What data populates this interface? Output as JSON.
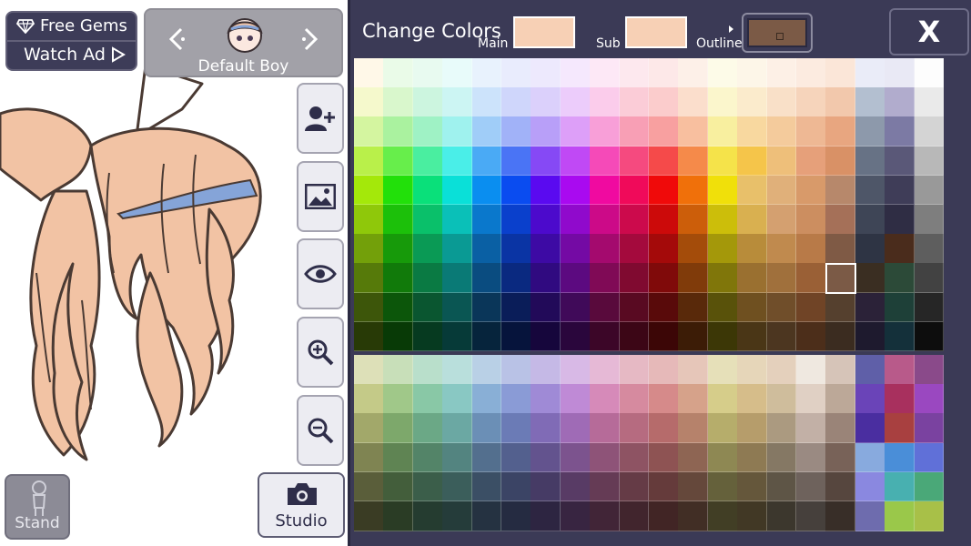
{
  "gems": {
    "label": "Free Gems",
    "icon": "gem-icon"
  },
  "ad": {
    "label": "Watch Ad",
    "icon": "play-icon"
  },
  "character": {
    "name": "Default Boy"
  },
  "side_buttons": [
    {
      "name": "add-character-button",
      "icon": "add-person-icon"
    },
    {
      "name": "background-button",
      "icon": "image-icon"
    },
    {
      "name": "visibility-button",
      "icon": "eye-icon"
    },
    {
      "name": "zoom-in-button",
      "icon": "zoom-in-icon"
    },
    {
      "name": "zoom-out-button",
      "icon": "zoom-out-icon"
    }
  ],
  "stand": {
    "label": "Stand"
  },
  "studio": {
    "label": "Studio",
    "icon": "camera-icon"
  },
  "colors_panel": {
    "title": "Change Colors",
    "main_label": "Main",
    "sub_label": "Sub",
    "outline_label": "Outline",
    "main_color": "#f7d0b5",
    "sub_color": "#f7d0b5",
    "outline_color": "#7b5a46"
  },
  "close": {
    "label": "X"
  },
  "palette": {
    "selected": {
      "row": 7,
      "col": 16
    },
    "top_rows": [
      [
        "#fff8e8",
        "#eafbe8",
        "#e8faf0",
        "#e8fbfa",
        "#e8f2fd",
        "#e9ecfd",
        "#ede9fd",
        "#f5e8fd",
        "#fde8f6",
        "#fde8ee",
        "#fde8e8",
        "#fdf0e8",
        "#fdfbe8",
        "#fdf6e8",
        "#fdf0e6",
        "#fcebe0",
        "#fbe6d8",
        "#eaecf8",
        "#e9e9f5",
        "#fdfdfd"
      ],
      [
        "#f5f9cc",
        "#d9f7cc",
        "#ccf5df",
        "#ccf5f3",
        "#cce3fb",
        "#cfd6fb",
        "#dbd0fb",
        "#ecccfb",
        "#fbcceb",
        "#fbccd7",
        "#fbcccc",
        "#fbdecc",
        "#fbf6cc",
        "#fbebcc",
        "#f9e0c8",
        "#f6d4bb",
        "#f2c8ac",
        "#b3bfd0",
        "#b1accd",
        "#eaeaea"
      ],
      [
        "#d4f5a0",
        "#aaf29f",
        "#9ff2c5",
        "#9ff2ee",
        "#a0cdf8",
        "#a1b2f8",
        "#b89ff8",
        "#dd9ff8",
        "#f89fd8",
        "#f89fb5",
        "#f8a0a0",
        "#f8bf9f",
        "#f8ef9f",
        "#f8d89f",
        "#f4cb9c",
        "#eeb894",
        "#e8a680",
        "#8d99ab",
        "#7c7aa4",
        "#d4d4d4"
      ],
      [
        "#b9f04a",
        "#67ee4b",
        "#4aeea0",
        "#4aeee8",
        "#4aaaf5",
        "#4a74f5",
        "#8649f5",
        "#c049f5",
        "#f54ab8",
        "#f54a7f",
        "#f54a4a",
        "#f58a4a",
        "#f5e34a",
        "#f5c54a",
        "#eebf7a",
        "#e6a07a",
        "#d99166",
        "#677285",
        "#5a5878",
        "#b8b8b8"
      ],
      [
        "#a4e80a",
        "#22e00a",
        "#0ae07a",
        "#0ae0d8",
        "#0a8ef0",
        "#0a4cf0",
        "#5a0af0",
        "#a90af0",
        "#f00aa0",
        "#f00a5a",
        "#f00a0a",
        "#f0700a",
        "#f0e00a",
        "#e8c06a",
        "#e0b07a",
        "#d89a6a",
        "#b7886b",
        "#4e5668",
        "#3f3d58",
        "#999999"
      ],
      [
        "#8fc80a",
        "#1cc00a",
        "#0ac06a",
        "#0ac0b8",
        "#0a78cc",
        "#0a40cc",
        "#4c0acc",
        "#900acc",
        "#cc0a88",
        "#cc0a4c",
        "#cc0a0a",
        "#cc5e0a",
        "#ccbe0a",
        "#d9b050",
        "#d4a070",
        "#cc8e60",
        "#a57058",
        "#3e4556",
        "#2f2d44",
        "#7e7e7e"
      ],
      [
        "#73a00a",
        "#179a0a",
        "#0a9a55",
        "#0a9a94",
        "#0a60a4",
        "#0a34a4",
        "#3d0aa4",
        "#740aa4",
        "#a40a6e",
        "#a40a3d",
        "#a40a0a",
        "#a44c0a",
        "#a4980a",
        "#b88c3a",
        "#c08a4e",
        "#b87a48",
        "#7f5a45",
        "#2e3444",
        "#4a2c1c",
        "#5e5e5e"
      ],
      [
        "#567a0a",
        "#117a0a",
        "#0a7a43",
        "#0a7a76",
        "#0a4c80",
        "#0a2980",
        "#300a80",
        "#5c0a80",
        "#800a56",
        "#800a30",
        "#800a0a",
        "#803b0a",
        "#80760a",
        "#9a7030",
        "#a0703c",
        "#9a6036",
        "#7b5a46",
        "#3a2e22",
        "#2c4a38",
        "#424242"
      ],
      [
        "#3d560a",
        "#0c560a",
        "#0a5630",
        "#0a5653",
        "#0a3659",
        "#0a1d59",
        "#220a59",
        "#400a59",
        "#590a3c",
        "#590a22",
        "#590a0a",
        "#59290a",
        "#59520a",
        "#6f5020",
        "#704e2a",
        "#704426",
        "#55402e",
        "#2b2238",
        "#1e4038",
        "#262626"
      ],
      [
        "#283a06",
        "#083a06",
        "#063a20",
        "#063a38",
        "#06243c",
        "#06143c",
        "#16063c",
        "#2a063c",
        "#3c0628",
        "#3c0616",
        "#3c0606",
        "#3c1c06",
        "#3c3706",
        "#4a3616",
        "#4c3620",
        "#4c2e1a",
        "#3b2c20",
        "#1e1a2e",
        "#14303a",
        "#0d0d0d"
      ]
    ],
    "bottom_rows": [
      [
        "#dde0b8",
        "#c8dfb9",
        "#b9dfcb",
        "#b9dfdc",
        "#b9d0e6",
        "#b9c2e6",
        "#c5b9e6",
        "#d8b9e6",
        "#e6b9d6",
        "#e6b9c4",
        "#e6b9b9",
        "#e6c6b9",
        "#e6e0b9",
        "#e6d6b9",
        "#e4d0bc",
        "#efe8e0",
        "#d6c4b8",
        "#5f5fa8",
        "#b85a8a",
        "#8a4a8a"
      ],
      [
        "#c4ca88",
        "#a0c889",
        "#89c8a6",
        "#89c8c3",
        "#89afd6",
        "#8a9bd6",
        "#9f8ad6",
        "#bf8ad6",
        "#d68ab9",
        "#d68a9f",
        "#d68a8a",
        "#d6a28a",
        "#d6cd8a",
        "#d6bd8a",
        "#cfbd9c",
        "#e0d0c4",
        "#bca898",
        "#6a44b8",
        "#a8305e",
        "#9a48c0"
      ],
      [
        "#a2a86a",
        "#7da86b",
        "#6ba886",
        "#6ba8a3",
        "#6b8fb6",
        "#6b7bb6",
        "#806bb6",
        "#9f6bb6",
        "#b66b99",
        "#b66b80",
        "#b66b6b",
        "#b6826b",
        "#b6ad6b",
        "#b69d6b",
        "#ab9a80",
        "#c2b0a6",
        "#9a8478",
        "#4a2ea0",
        "#a84040",
        "#7a42a0"
      ],
      [
        "#7f8452",
        "#5f8453",
        "#538468",
        "#538480",
        "#536f8e",
        "#53608e",
        "#63538e",
        "#7c538e",
        "#8e5378",
        "#8e5363",
        "#8e5353",
        "#8e6553",
        "#8e8853",
        "#8e7a53",
        "#857864",
        "#9a8a82",
        "#786258",
        "#88aade",
        "#4a8ed8",
        "#6070d8"
      ],
      [
        "#5a5e3a",
        "#435e3b",
        "#3b5e4a",
        "#3b5e5b",
        "#3b4f65",
        "#3b4465",
        "#463b65",
        "#583b65",
        "#653b55",
        "#653b46",
        "#653b3b",
        "#65483b",
        "#65613b",
        "#65573b",
        "#5e5546",
        "#6e625c",
        "#56463e",
        "#8a88e0",
        "#48b0b0",
        "#4aa878"
      ],
      [
        "#3a3c24",
        "#2a3c25",
        "#253c30",
        "#253c3a",
        "#253241",
        "#252b41",
        "#2d2541",
        "#382541",
        "#412537",
        "#41252d",
        "#412525",
        "#412e25",
        "#413e25",
        "#413825",
        "#3c372d",
        "#46403c",
        "#382e28",
        "#6e6cae",
        "#9ac84a",
        "#a8c048"
      ]
    ]
  }
}
